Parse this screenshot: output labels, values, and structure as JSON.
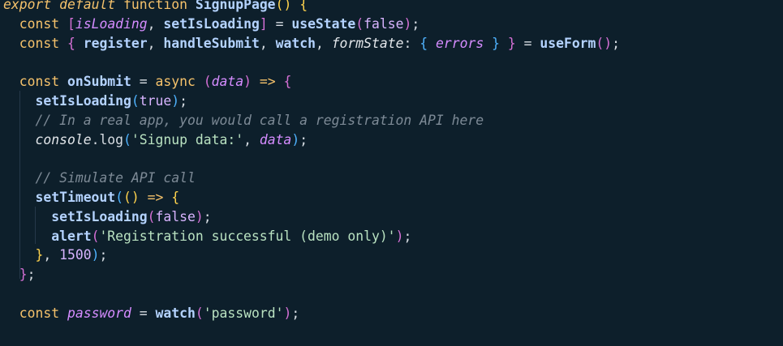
{
  "code": {
    "l0": {
      "kw1": "export",
      "kw2": "default",
      "kw3": "function",
      "name": "SignupPage",
      "open": "(",
      "close": ")",
      "brace": "{"
    },
    "l1": {
      "kw": "const",
      "lb": "[",
      "a": "isLoading",
      "comma": ",",
      "b": "setIsLoading",
      "rb": "]",
      "eq": "=",
      "fn": "useState",
      "lp": "(",
      "arg": "false",
      "rp": ")",
      "semi": ";"
    },
    "l2": {
      "kw": "const",
      "lb": "{",
      "a": "register",
      "c1": ",",
      "b": "handleSubmit",
      "c2": ",",
      "c": "watch",
      "c3": ",",
      "d": "formState",
      "colon": ":",
      "lb2": "{",
      "e": "errors",
      "rb2": "}",
      "rb": "}",
      "eq": "=",
      "fn": "useForm",
      "lp": "(",
      "rp": ")",
      "semi": ";"
    },
    "l4": {
      "kw": "const",
      "name": "onSubmit",
      "eq": "=",
      "async": "async",
      "lp": "(",
      "param": "data",
      "rp": ")",
      "arrow": "=>",
      "brace": "{"
    },
    "l5": {
      "fn": "setIsLoading",
      "lp": "(",
      "arg": "true",
      "rp": ")",
      "semi": ";"
    },
    "l6": {
      "comment": "// In a real app, you would call a registration API here"
    },
    "l7": {
      "obj": "console",
      "dot": ".",
      "fn": "log",
      "lp": "(",
      "str": "'Signup data:'",
      "comma": ",",
      "arg": "data",
      "rp": ")",
      "semi": ";"
    },
    "l9": {
      "comment": "// Simulate API call"
    },
    "l10": {
      "fn": "setTimeout",
      "lp": "(",
      "lp2": "(",
      "rp2": ")",
      "arrow": "=>",
      "brace": "{"
    },
    "l11": {
      "fn": "setIsLoading",
      "lp": "(",
      "arg": "false",
      "rp": ")",
      "semi": ";"
    },
    "l12": {
      "fn": "alert",
      "lp": "(",
      "str": "'Registration successful (demo only)'",
      "rp": ")",
      "semi": ";"
    },
    "l13": {
      "brace": "}",
      "comma": ",",
      "num": "1500",
      "rp": ")",
      "semi": ";"
    },
    "l14": {
      "brace": "}",
      "semi": ";"
    },
    "l16": {
      "kw": "const",
      "name": "password",
      "eq": "=",
      "fn": "watch",
      "lp": "(",
      "str": "'password'",
      "rp": ")",
      "semi": ";"
    }
  }
}
